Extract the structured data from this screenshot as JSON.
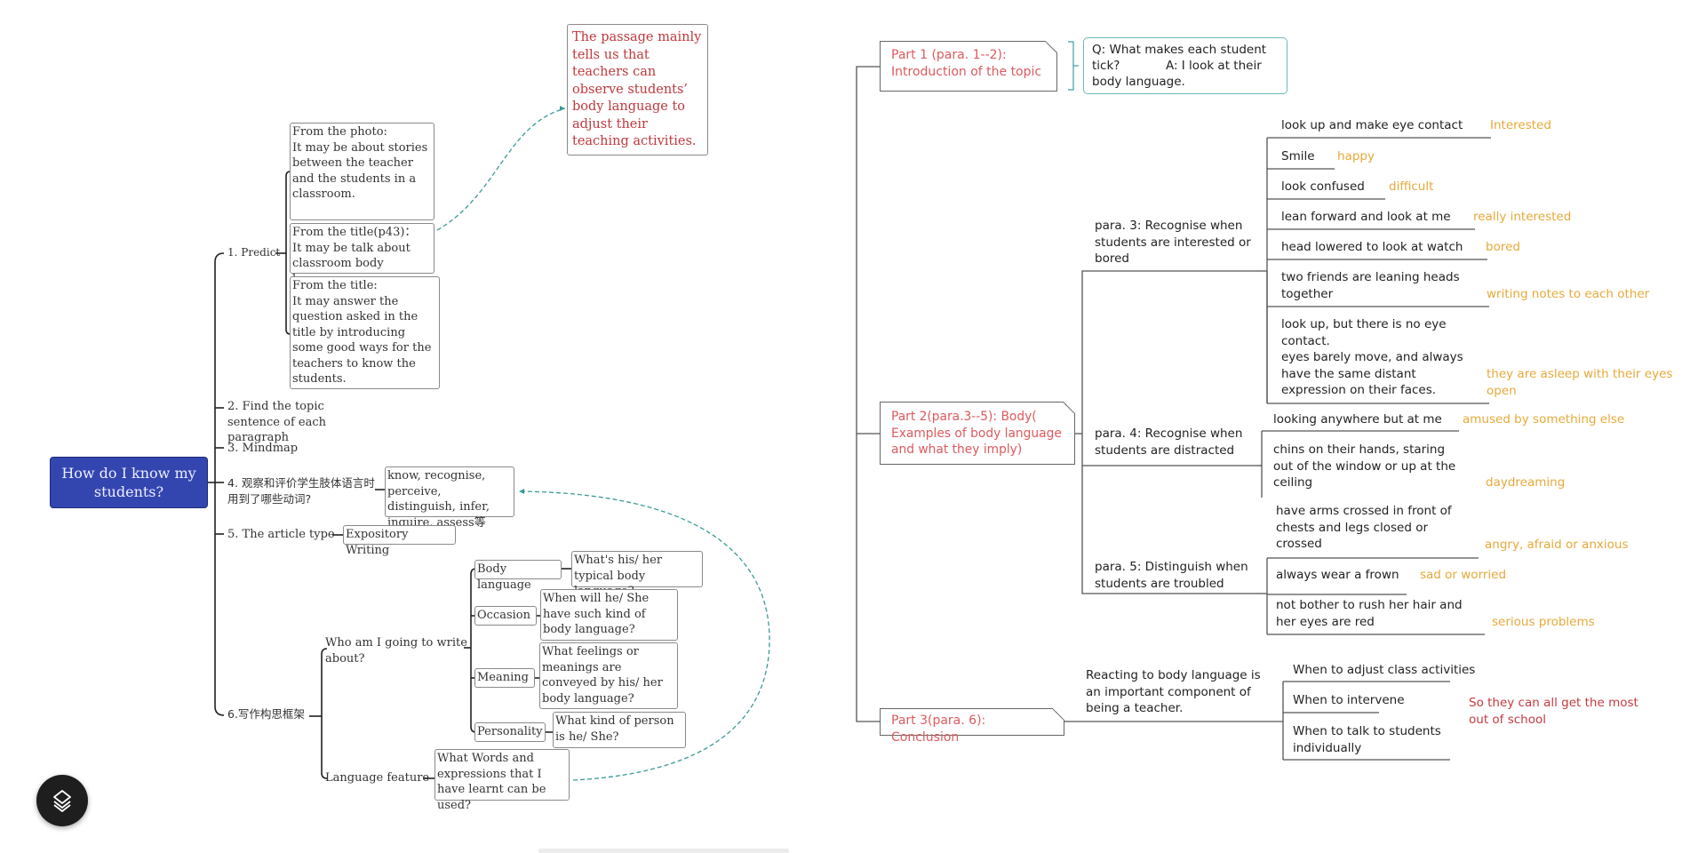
{
  "left_map": {
    "root": "How do I know my students?",
    "branches": {
      "predict": {
        "label": "1. Predict",
        "notes": [
          "From the photo:\nIt may be about stories between the teacher and the students in a classroom.",
          "From the title(p43)：\nIt may be talk about classroom body language",
          "From the title:\nIt may answer the question asked in the title by introducing some good ways for the teachers to know the students."
        ],
        "linked_note": "The passage mainly tells us that teachers can observe students’ body language to adjust their teaching activities."
      },
      "topic_sentence": "2. Find the topic sentence of each paragraph",
      "mindmap": "3. Mindmap",
      "verbs": {
        "label": "4. 观察和评价学生肢体语言时用到了哪些动词?",
        "answer": "know, recognise, perceive, distinguish, infer, inquire, assess等"
      },
      "article_type": {
        "label": "5. The article type",
        "answer": "Expository Writing"
      },
      "writing_frame": {
        "label": "6.写作构思框架",
        "who": {
          "label": "Who am I going to write about?",
          "items": [
            {
              "label": "Body language",
              "question": "What's his/ her typical body language?"
            },
            {
              "label": "Occasion",
              "question": "When will he/ She have such kind of body language?"
            },
            {
              "label": "Meaning",
              "question": "What feelings or meanings are conveyed by his/ her body language?"
            },
            {
              "label": "Personality",
              "question": "What kind of person is he/ She?"
            }
          ]
        },
        "language": {
          "label": "Language feature",
          "question": "What Words and expressions that I have learnt can be used?"
        }
      }
    }
  },
  "right_map": {
    "part1": {
      "label": "Part 1 (para. 1--2):\nIntroduction of the topic",
      "qa": "Q: What makes each student tick?            A: I look at their body language."
    },
    "part2": {
      "label": "Part 2(para.3--5): Body(\nExamples of body language and what they imply)",
      "para3": {
        "label": "para. 3: Recognise when students are interested or bored",
        "items": [
          {
            "cue": "look up and make eye contact",
            "meaning": "Interested"
          },
          {
            "cue": "Smile",
            "meaning": "happy"
          },
          {
            "cue": "look confused",
            "meaning": "difficult"
          },
          {
            "cue": "lean forward and look at me",
            "meaning": "really interested"
          },
          {
            "cue": "head lowered to look at watch",
            "meaning": "bored"
          },
          {
            "cue": "two friends are leaning heads together",
            "meaning": "writing notes to each other"
          },
          {
            "cue": "look up, but there is no eye contact.\neyes barely move, and always have the same distant expression on their faces.",
            "meaning": "they are asleep with their eyes open"
          }
        ]
      },
      "para4": {
        "label": "para. 4: Recognise when students are distracted",
        "items": [
          {
            "cue": "looking anywhere but at me",
            "meaning": "amused by something else"
          },
          {
            "cue": "chins on their hands, staring out of the window or up at the ceiling",
            "meaning": "daydreaming"
          }
        ]
      },
      "para5": {
        "label": "para. 5: Distinguish when students are troubled",
        "items": [
          {
            "cue": "have arms crossed in front of chests and legs closed or crossed",
            "meaning": "angry, afraid or anxious"
          },
          {
            "cue": "always wear a frown",
            "meaning": "sad or worried"
          },
          {
            "cue": "not bother to rush her hair and her eyes are red",
            "meaning": "serious problems"
          }
        ]
      }
    },
    "part3": {
      "label": "Part 3(para. 6): Conclusion",
      "statement": "Reacting to body language is an important component of being a teacher.",
      "items": [
        "When to adjust class activities",
        "When to intervene",
        "When to talk to students individually"
      ],
      "outcome": "So they can all get the most out of school"
    }
  },
  "colors": {
    "root_fill": "#3346b0",
    "note_red": "#c0383d",
    "part_red": "#dd5a5e",
    "meaning_orange": "#e6a93a",
    "link_teal": "#3a9a96"
  },
  "controls": {
    "layers_button_icon": "layers-icon"
  }
}
